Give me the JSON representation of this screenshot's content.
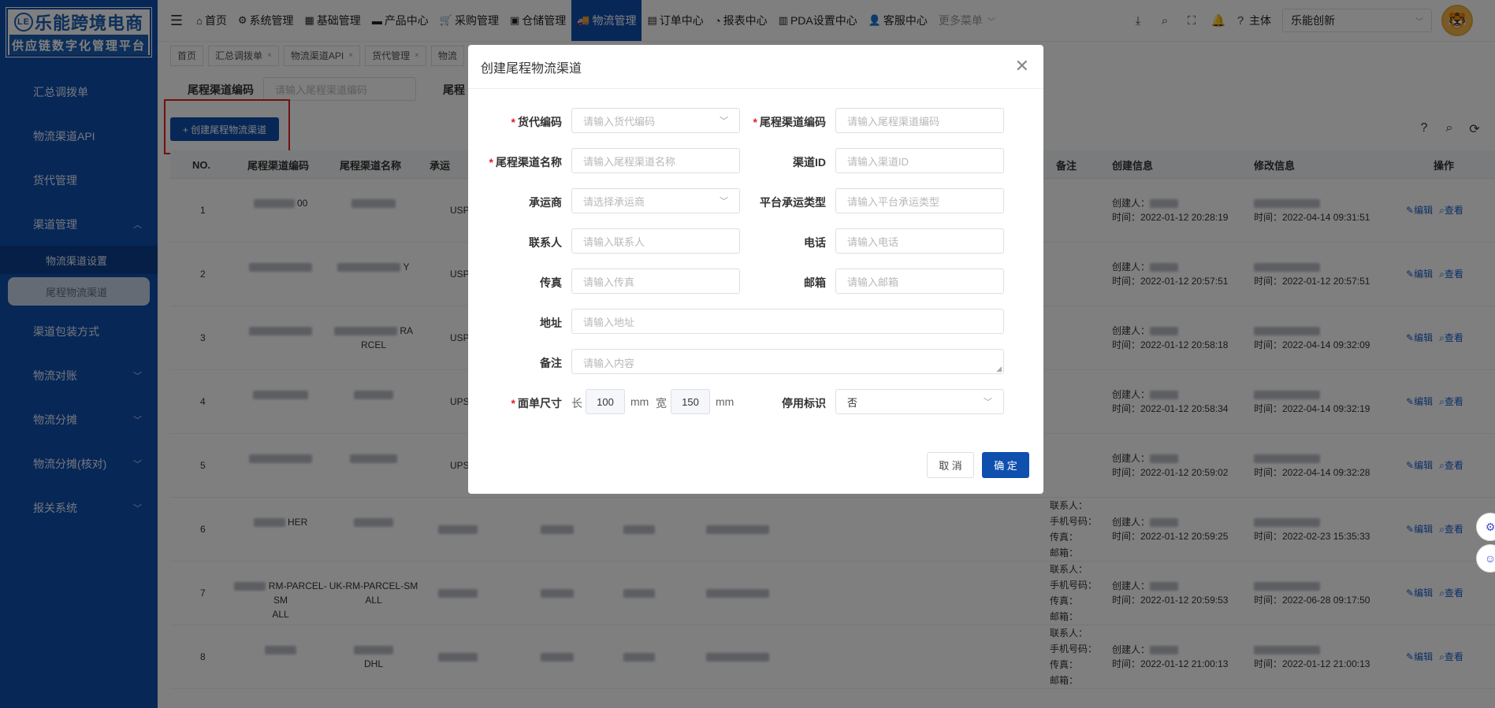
{
  "logo": {
    "mark": "LE",
    "name": "乐能跨境电商",
    "tagline": "供应链数字化管理平台"
  },
  "sidebar": {
    "items": [
      {
        "label": "汇总调拨单"
      },
      {
        "label": "物流渠道API"
      },
      {
        "label": "货代管理"
      },
      {
        "label": "渠道管理",
        "expanded": true
      },
      {
        "label": "渠道包装方式"
      },
      {
        "label": "物流对账"
      },
      {
        "label": "物流分摊"
      },
      {
        "label": "物流分摊(核对)"
      },
      {
        "label": "报关系统"
      }
    ],
    "subitems": [
      {
        "label": "物流渠道设置"
      },
      {
        "label": "尾程物流渠道",
        "active": true
      }
    ]
  },
  "topnav": {
    "menu_toggle": "☰",
    "items": [
      {
        "icon": "⌂",
        "label": "首页"
      },
      {
        "icon": "⚙",
        "label": "系统管理"
      },
      {
        "icon": "▦",
        "label": "基础管理"
      },
      {
        "icon": "▬",
        "label": "产品中心"
      },
      {
        "icon": "🛒",
        "label": "采购管理"
      },
      {
        "icon": "▣",
        "label": "仓储管理"
      },
      {
        "icon": "🚚",
        "label": "物流管理",
        "active": true
      },
      {
        "icon": "▤",
        "label": "订单中心"
      },
      {
        "icon": "◔",
        "label": "报表中心"
      },
      {
        "icon": "▥",
        "label": "PDA设置中心"
      },
      {
        "icon": "👤",
        "label": "客服中心"
      }
    ],
    "more": "更多菜单",
    "subject_label": "主体",
    "company": "乐能创新"
  },
  "tabs": [
    {
      "label": "首页",
      "closable": false
    },
    {
      "label": "汇总调拨单",
      "closable": true
    },
    {
      "label": "物流渠道API",
      "closable": true
    },
    {
      "label": "货代管理",
      "closable": true
    },
    {
      "label": "物流",
      "closable": false
    }
  ],
  "filters": {
    "code_label": "尾程渠道编码",
    "code_placeholder": "请输入尾程渠道编码",
    "name_label": "尾程"
  },
  "create_button": "+ 创建尾程物流渠道",
  "table": {
    "headers": [
      "NO.",
      "尾程渠道编码",
      "尾程渠道名称",
      "承运",
      "备注",
      "创建信息",
      "修改信息",
      "操作"
    ],
    "actions": {
      "edit": "编辑",
      "view": "查看"
    },
    "rows": [
      {
        "no": "1",
        "code": "00",
        "carrier": "USP",
        "creator": "创建人：",
        "created": "时间：2022-01-12 20:28:19",
        "modified": "时间：2022-04-14 09:31:51"
      },
      {
        "no": "2",
        "name_tail": "Y",
        "carrier": "USP",
        "creator": "创建人：",
        "created": "时间：2022-01-12 20:57:51",
        "modified": "时间：2022-01-12 20:57:51"
      },
      {
        "no": "3",
        "name_tail": "RA",
        "name_line2": "RCEL",
        "carrier": "USP",
        "creator": "创建人：",
        "created": "时间：2022-01-12 20:58:18",
        "modified": "时间：2022-04-14 09:32:09"
      },
      {
        "no": "4",
        "carrier": "UPS",
        "creator": "创建人：",
        "created": "时间：2022-01-12 20:58:34",
        "modified": "时间：2022-04-14 09:32:19"
      },
      {
        "no": "5",
        "carrier": "UPS",
        "creator": "创建人：",
        "created": "时间：2022-01-12 20:59:02",
        "modified": "时间：2022-04-14 09:32:28"
      },
      {
        "no": "6",
        "code": "HER",
        "creator": "创建人：",
        "created": "时间：2022-01-12 20:59:25",
        "modified": "时间：2022-02-23 15:35:33"
      },
      {
        "no": "7",
        "code": "RM-PARCEL-SM",
        "code_line2": "ALL",
        "name": "UK-RM-PARCEL-SM",
        "name_line2": "ALL",
        "creator": "创建人：",
        "created": "时间：2022-01-12 20:59:53",
        "modified": "时间：2022-06-28 09:17:50"
      },
      {
        "no": "8",
        "name_line2": "DHL",
        "creator": "创建人：",
        "created": "时间：2022-01-12 21:00:13",
        "modified": "时间：2022-01-12 21:00:13"
      }
    ],
    "contact_lines": [
      "联系人：",
      "手机号码：",
      "传真：",
      "邮箱："
    ]
  },
  "modal": {
    "title": "创建尾程物流渠道",
    "fields": {
      "forwarder_code": {
        "label": "货代编码",
        "placeholder": "请输入货代编码"
      },
      "tail_code": {
        "label": "尾程渠道编码",
        "placeholder": "请输入尾程渠道编码"
      },
      "tail_name": {
        "label": "尾程渠道名称",
        "placeholder": "请输入尾程渠道名称"
      },
      "channel_id": {
        "label": "渠道ID",
        "placeholder": "请输入渠道ID"
      },
      "carrier": {
        "label": "承运商",
        "placeholder": "请选择承运商"
      },
      "platform_type": {
        "label": "平台承运类型",
        "placeholder": "请输入平台承运类型"
      },
      "contact": {
        "label": "联系人",
        "placeholder": "请输入联系人"
      },
      "phone": {
        "label": "电话",
        "placeholder": "请输入电话"
      },
      "fax": {
        "label": "传真",
        "placeholder": "请输入传真"
      },
      "email": {
        "label": "邮箱",
        "placeholder": "请输入邮箱"
      },
      "address": {
        "label": "地址",
        "placeholder": "请输入地址"
      },
      "remark": {
        "label": "备注",
        "placeholder": "请输入内容"
      },
      "size": {
        "label": "面单尺寸",
        "length_label": "长",
        "length": "100",
        "width_label": "宽",
        "width": "150",
        "unit": "mm"
      },
      "disabled": {
        "label": "停用标识",
        "value": "否"
      }
    },
    "cancel": "取 消",
    "confirm": "确 定"
  },
  "colors": {
    "primary": "#0f4fae",
    "required": "#e02020",
    "link": "#1a5fd0"
  }
}
